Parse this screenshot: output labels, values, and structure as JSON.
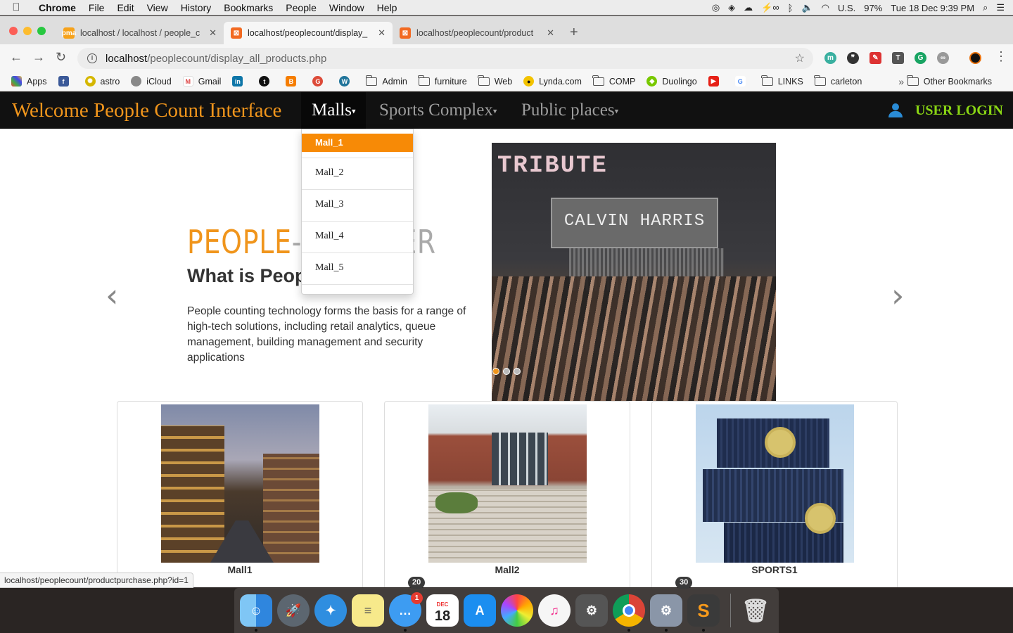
{
  "menubar": {
    "app_name": "Chrome",
    "menus": [
      "File",
      "Edit",
      "View",
      "History",
      "Bookmarks",
      "People",
      "Window",
      "Help"
    ],
    "input_source": "U.S.",
    "battery": "97%",
    "datetime": "Tue 18 Dec  9:39 PM"
  },
  "tabs": [
    {
      "title": "localhost / localhost / people_c",
      "icon": "phpmyadmin-icon",
      "active": false
    },
    {
      "title": "localhost/peoplecount/display_",
      "icon": "xampp-icon",
      "active": true
    },
    {
      "title": "localhost/peoplecount/product",
      "icon": "xampp-icon",
      "active": false
    }
  ],
  "address": {
    "host": "localhost",
    "path": "/peoplecount/display_all_products.php"
  },
  "bookmarks": {
    "items": [
      "Apps",
      "astro",
      "iCloud",
      "Gmail",
      "Admin",
      "furniture",
      "Web",
      "Lynda.com",
      "COMP",
      "Duolingo",
      "LINKS",
      "carleton"
    ],
    "more": "»",
    "other": "Other Bookmarks"
  },
  "site": {
    "brand": "Welcome People Count Interface",
    "nav": [
      {
        "label": "Malls",
        "active": true
      },
      {
        "label": "Sports Complex",
        "active": false
      },
      {
        "label": "Public places",
        "active": false
      }
    ],
    "login": "USER LOGIN",
    "dropdown": [
      "Mall_1",
      "Mall_2",
      "Mall_3",
      "Mall_4",
      "Mall_5"
    ],
    "hero": {
      "title_orange": "PEOPLE",
      "title_grey": "-COUNTER",
      "subtitle": "What is People Counter?",
      "text": "People counting technology forms the basis for a range of high-tech solutions, including retail analytics, queue management, building management and security applications",
      "image_top_text": "TRIBUTE",
      "image_stage_text": "CALVIN HARRIS"
    },
    "arrows": {
      "prev": "‹",
      "next": "›"
    },
    "cards": [
      {
        "caption": "Mall1"
      },
      {
        "caption": "Mall2"
      },
      {
        "caption": "SPORTS1"
      }
    ]
  },
  "status_url": "localhost/peoplecount/productpurchase.php?id=1",
  "dock": {
    "badges": {
      "left": "20",
      "right": "30"
    },
    "messages_count": "1",
    "calendar_month": "DEC",
    "calendar_day": "18"
  },
  "colors": {
    "accent_orange": "#f78a06",
    "brand_orange": "#f0951c",
    "login_green": "#8ad614",
    "navbar_bg": "#111111"
  }
}
